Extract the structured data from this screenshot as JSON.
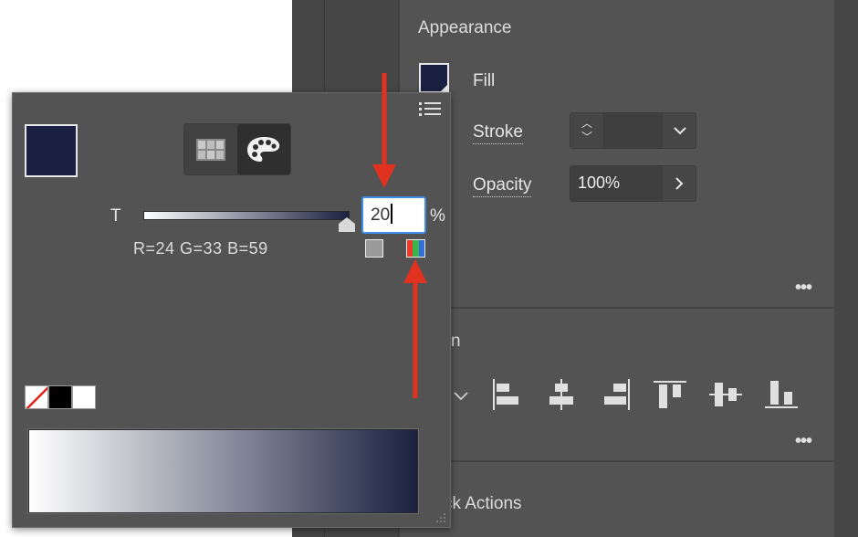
{
  "appearance": {
    "title": "Appearance",
    "fill_label": "Fill",
    "stroke_label": "Stroke",
    "opacity_label": "Opacity",
    "opacity_value": "100%",
    "fill_color": "#1a2140"
  },
  "align": {
    "title_fragment": "n"
  },
  "quick_actions": {
    "title_fragment": "ck Actions"
  },
  "color_popup": {
    "tint_label": "T",
    "tint_value": "20",
    "percent_sign": "%",
    "rgb_readout": "R=24 G=33 B=59",
    "swatch_color": "#1a2140",
    "modes": [
      "swatches-icon",
      "color-palette-icon"
    ],
    "active_mode": "color-palette-icon"
  },
  "colors": {
    "accent_focus": "#3d8ee8",
    "annotation_arrow": "#e0321e",
    "panel_bg": "#535353"
  }
}
